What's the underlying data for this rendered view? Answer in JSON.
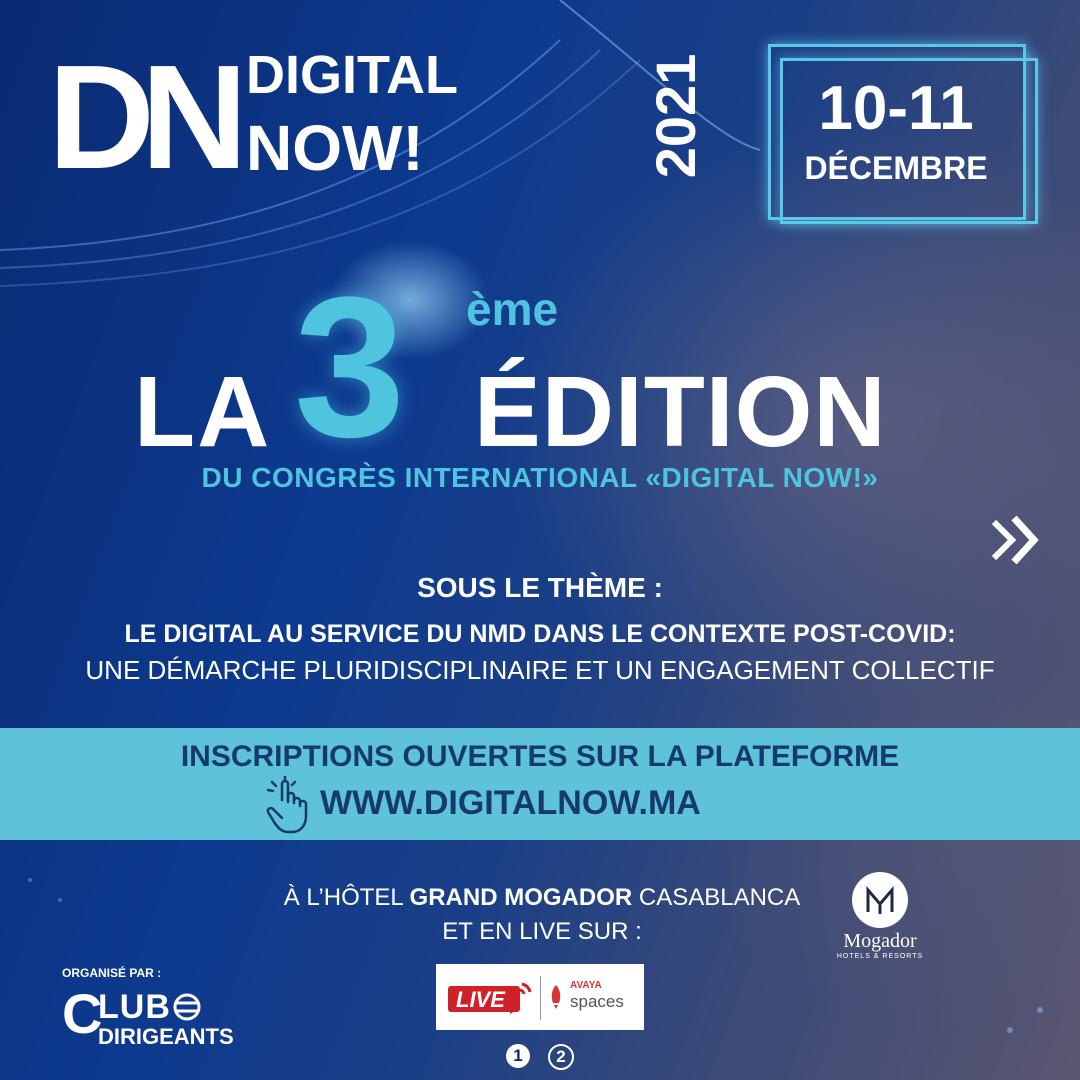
{
  "logo": {
    "mark": "DN",
    "word_1": "DIGITAL",
    "word_2": "NOW!"
  },
  "event_date": {
    "year": "2021",
    "days": "10-11",
    "month": "DÉCEMBRE"
  },
  "edition": {
    "article": "LA",
    "number": "3",
    "ordinal_suffix": "ème",
    "word": "ÉDITION",
    "subtitle": "DU CONGRÈS INTERNATIONAL «DIGITAL NOW!»"
  },
  "theme": {
    "heading": "SOUS LE THÈME :",
    "line_1": "LE DIGITAL AU SERVICE DU NMD DANS LE CONTEXTE POST-COVID:",
    "line_2": "UNE DÉMARCHE PLURIDISCIPLINAIRE ET UN ENGAGEMENT COLLECTIF"
  },
  "registration": {
    "text": "INSCRIPTIONS OUVERTES SUR LA PLATEFORME",
    "url": "WWW.DIGITALNOW.MA"
  },
  "venue": {
    "prefix": "À L’HÔTEL",
    "hotel": "GRAND MOGADOR",
    "city": "CASABLANCA",
    "live_text": "ET EN LIVE SUR :"
  },
  "hotel_logo": {
    "name": "Mogador",
    "tagline": "HOTELS & RESORTS"
  },
  "live_platforms": {
    "live_logo_text": "LIVE",
    "avaya_brand": "AVAYA",
    "avaya_product": "spaces",
    "number_1": "1",
    "number_2": "2"
  },
  "organizer": {
    "label": "ORGANISÉ PAR :",
    "initial": "C",
    "name_1": "LUB",
    "name_2": "DIRIGEANTS"
  },
  "colors": {
    "accent": "#4fc4de",
    "band": "#5ec3d8",
    "band_text": "#163a6e",
    "background": "#0b2a6b"
  }
}
